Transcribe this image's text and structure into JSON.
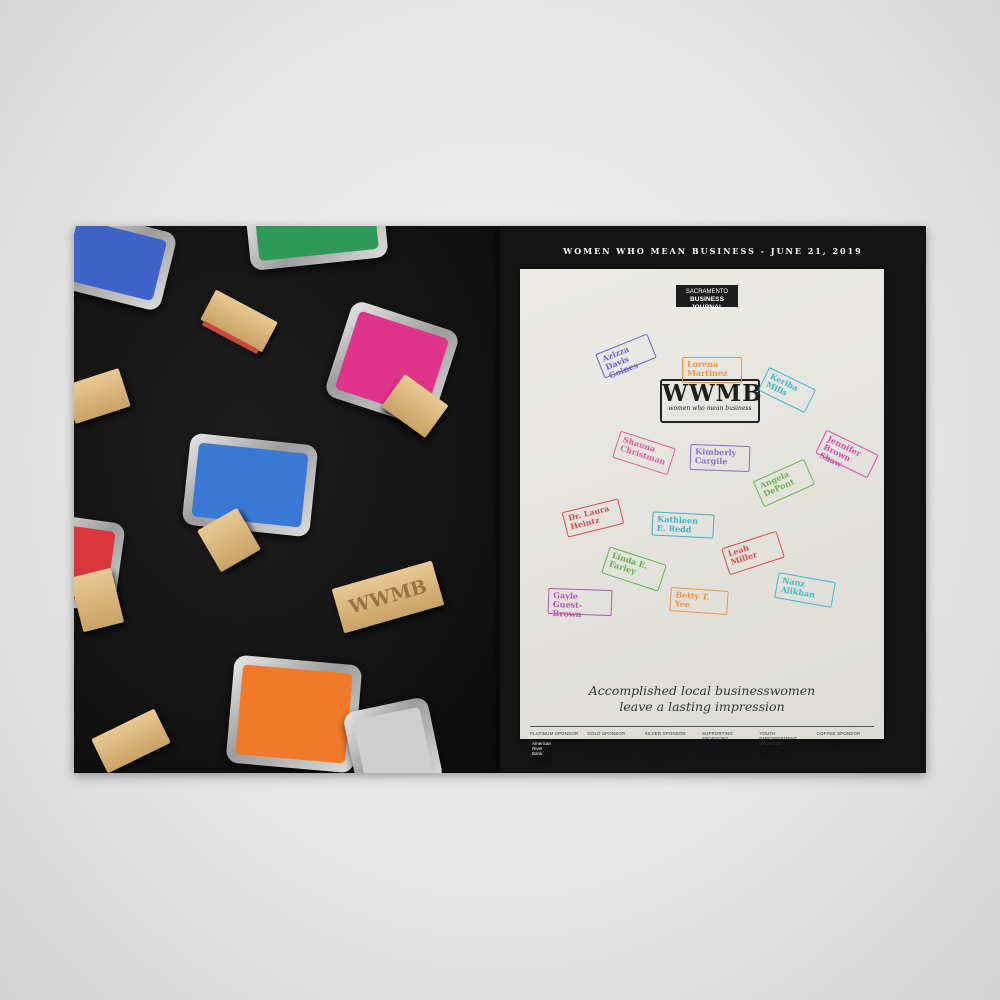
{
  "header": {
    "title": "WOMEN WHO MEAN BUSINESS - JUNE 21, 2019"
  },
  "masthead": {
    "line1": "SACRAMENTO",
    "line2": "BUSINESS JOURNAL"
  },
  "logo": {
    "title": "WWMB",
    "subtitle": "women who mean business"
  },
  "honorees": [
    {
      "name": "Azizza Davis\nGoines",
      "color": "#5a4fc9"
    },
    {
      "name": "Lorena\nMartinez",
      "color": "#f08a2c"
    },
    {
      "name": "Keriba\nMills",
      "color": "#2bb3c7"
    },
    {
      "name": "Jennifer\nBrown Shaw",
      "color": "#d03a9d"
    },
    {
      "name": "Shauna\nChristman",
      "color": "#e04a8f"
    },
    {
      "name": "Kimberly\nCargile",
      "color": "#7a5fd1"
    },
    {
      "name": "Angela\nDePont",
      "color": "#5bb23d"
    },
    {
      "name": "Dr. Laura\nHeintz",
      "color": "#d83a36"
    },
    {
      "name": "Kathleen\nE. Redd",
      "color": "#2fa7c2"
    },
    {
      "name": "Leah\nMiller",
      "color": "#d83a36"
    },
    {
      "name": "Linda E.\nFarley",
      "color": "#4faa3a"
    },
    {
      "name": "Nanz\nAlikhan",
      "color": "#2bb3c7"
    },
    {
      "name": "Gayle\nGuest-Brown",
      "color": "#b23fae"
    },
    {
      "name": "Betty T.\nYee",
      "color": "#f08a2c"
    }
  ],
  "tagline": {
    "line1": "Accomplished local businesswomen",
    "line2": "leave a lasting impression"
  },
  "sponsors": [
    {
      "category": "PLATINUM SPONSOR",
      "name": "American River Bank"
    },
    {
      "category": "GOLD SPONSOR",
      "name": "UC DAVIS HEALTH"
    },
    {
      "category": "SILVER SPONSOR",
      "name": "SACRAMENTO STATE COLLEGE OF BUSINESS ADMINISTRATION"
    },
    {
      "category": "SUPPORTING SPONSORS",
      "name": "MULVANEY'S B&L TRI COUNTIES BANK U.S. BANK"
    },
    {
      "category": "YOUTH EMPOWERMENT SPONSOR",
      "name": "SMUD"
    },
    {
      "category": "COFFEE SPONSOR",
      "name": "FIRST 5 SACRAMENTO"
    }
  ],
  "props": {
    "pad_colors": [
      "#3d63c9",
      "#2f9a57",
      "#e0338c",
      "#3a78d6",
      "#d8383d",
      "#f07a2a"
    ],
    "block_stamp_text": "WWMB"
  }
}
